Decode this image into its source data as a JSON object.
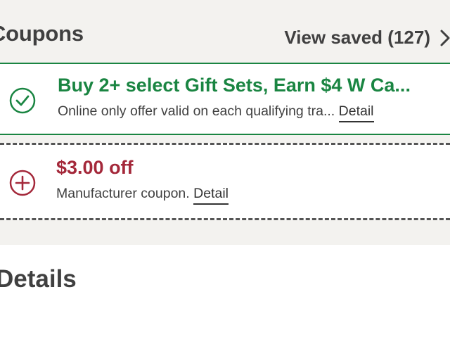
{
  "coupons_header": {
    "title": "Coupons",
    "view_saved": "View saved (127)"
  },
  "coupons": [
    {
      "state": "saved",
      "icon": "check-circle-icon",
      "title": "Buy 2+ select Gift Sets, Earn $4 W Ca...",
      "description": "Online only offer valid on each qualifying tra...",
      "detail_link": "Detail",
      "accent_color": "#1a8542"
    },
    {
      "state": "available",
      "icon": "plus-circle-icon",
      "title": "$3.00 off",
      "description": "Manufacturer coupon.",
      "detail_link": "Detail",
      "accent_color": "#a4283a"
    }
  ],
  "details_section": {
    "title": "Details"
  },
  "colors": {
    "background": "#f3f2ef",
    "saved_green": "#1a8542",
    "offer_red": "#a4283a",
    "text_dark": "#404040"
  }
}
